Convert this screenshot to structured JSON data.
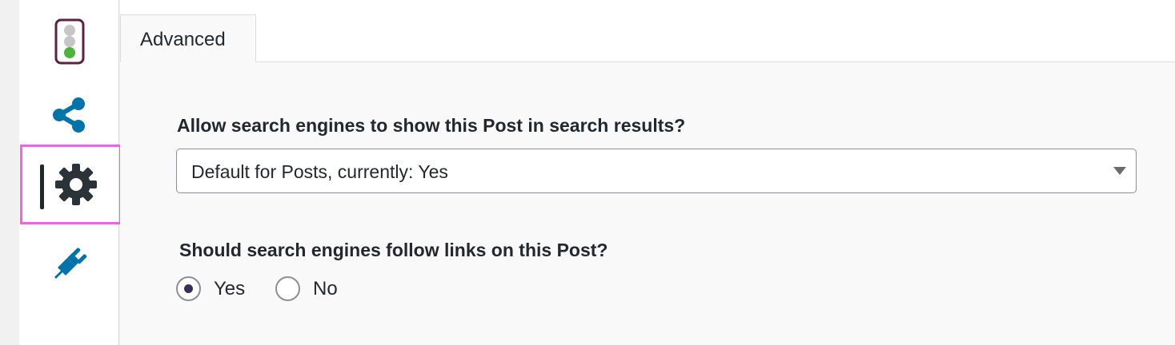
{
  "sidebar": {
    "items": [
      {
        "icon": "traffic-light-icon"
      },
      {
        "icon": "share-icon"
      },
      {
        "icon": "gear-icon",
        "active": true
      },
      {
        "icon": "plug-icon"
      }
    ]
  },
  "tabs": [
    {
      "label": "Advanced"
    }
  ],
  "advanced": {
    "search_visibility": {
      "question": "Allow search engines to show this Post in search results?",
      "selected": "Default for Posts, currently: Yes"
    },
    "follow_links": {
      "question": "Should search engines follow links on this Post?",
      "options": [
        {
          "label": "Yes",
          "checked": true
        },
        {
          "label": "No",
          "checked": false
        }
      ]
    }
  },
  "colors": {
    "accent_blue": "#0073aa",
    "highlight_pink": "#f65ef2",
    "traffic_green": "#4cb43a"
  }
}
